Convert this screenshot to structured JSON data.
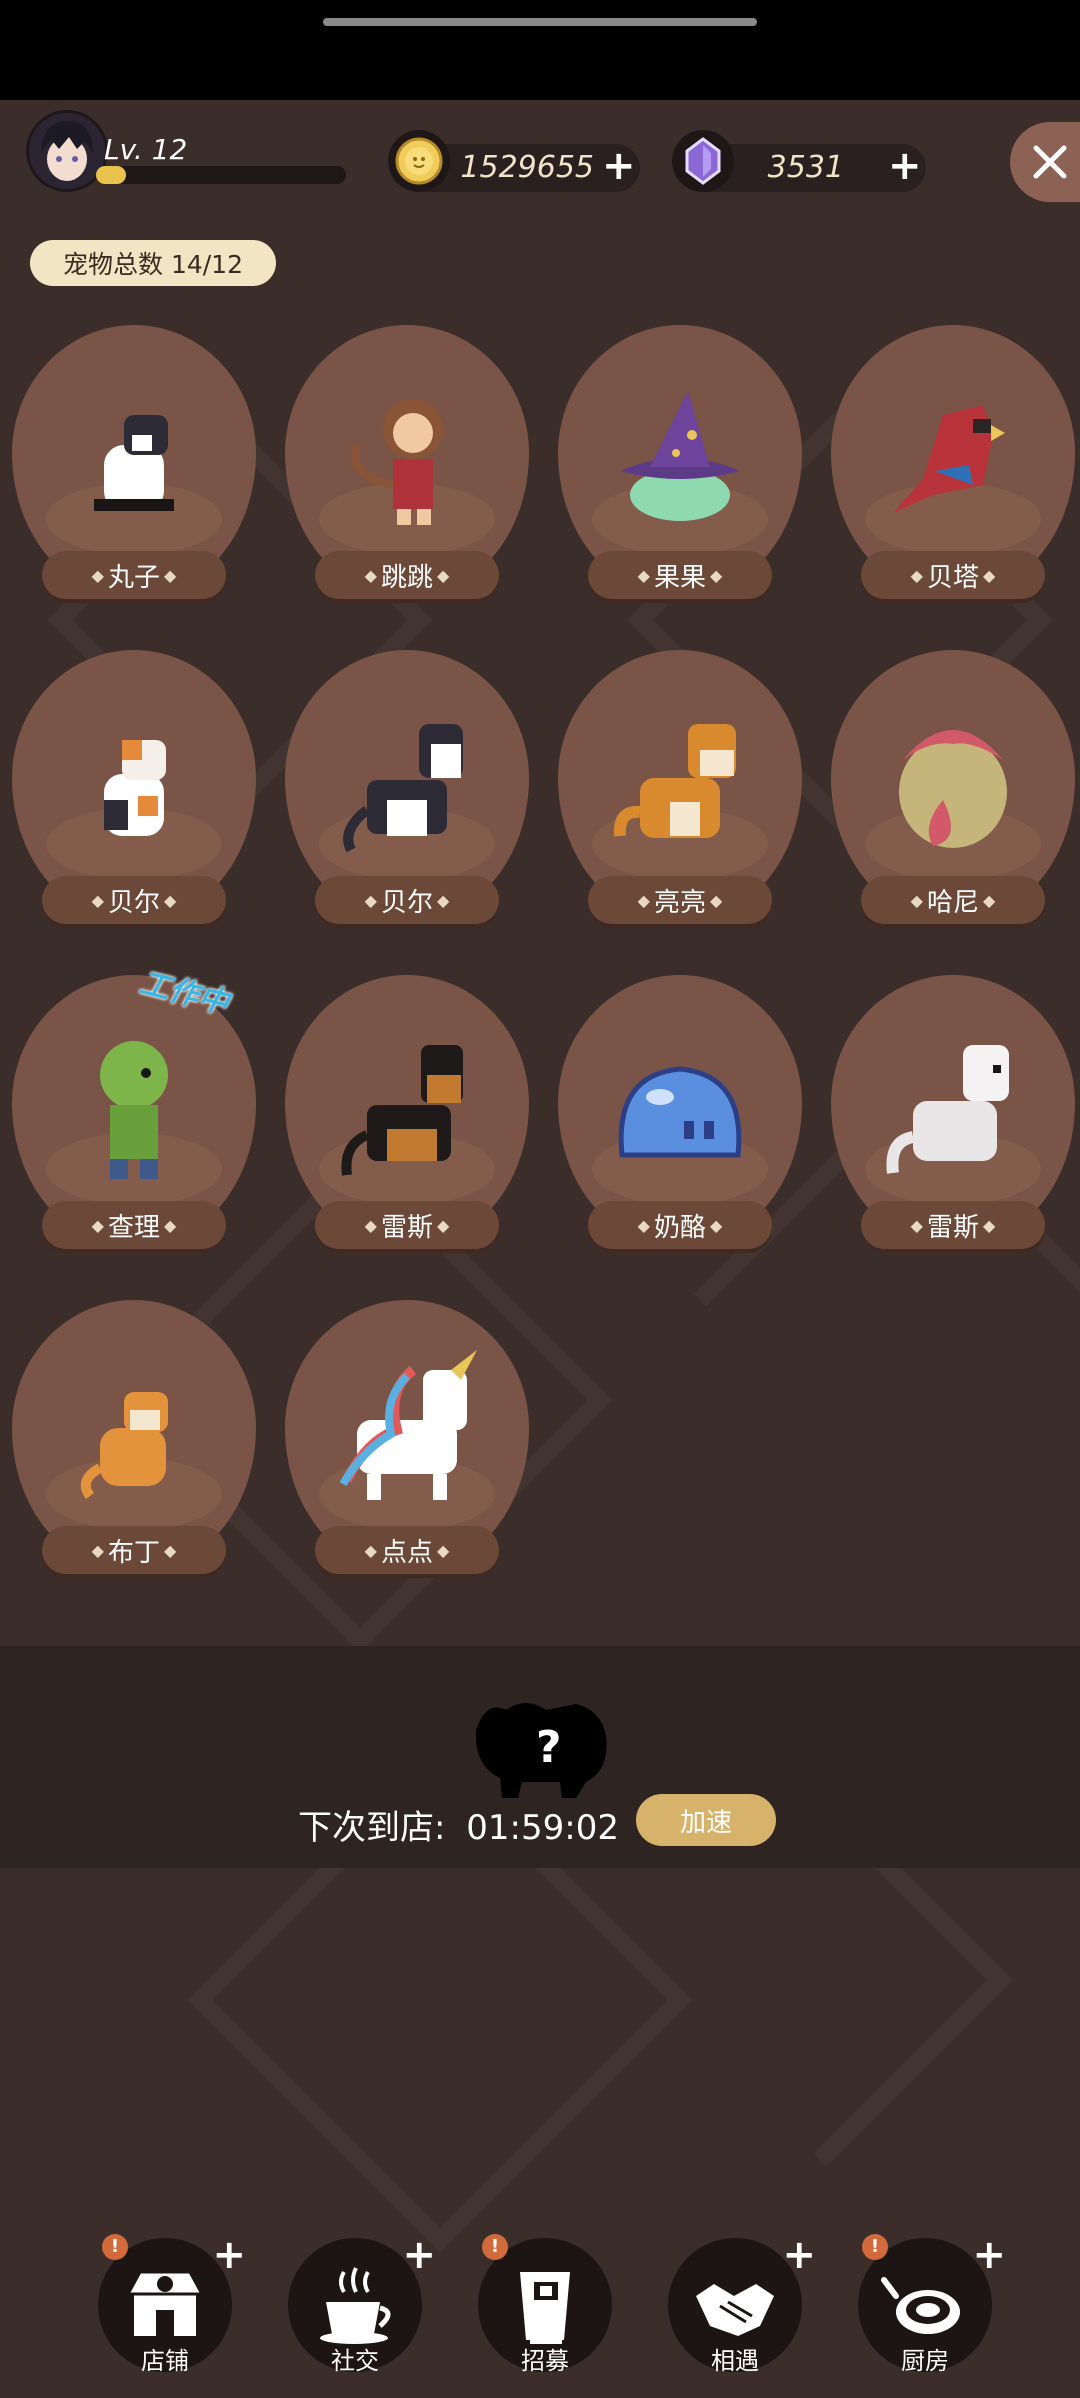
{
  "header": {
    "level_label": "Lv. 12",
    "xp_progress": 0.12,
    "coins": "1529655",
    "gems": "3531"
  },
  "pet_count_label": "宠物总数 14/12",
  "pets": [
    {
      "name": "丸子",
      "icon": "black-white-cat-icon"
    },
    {
      "name": "跳跳",
      "icon": "monkey-icon"
    },
    {
      "name": "果果",
      "icon": "wizard-hat-slime-icon"
    },
    {
      "name": "贝塔",
      "icon": "red-parrot-icon"
    },
    {
      "name": "贝尔",
      "icon": "calico-cat-icon"
    },
    {
      "name": "贝尔",
      "icon": "husky-icon"
    },
    {
      "name": "亮亮",
      "icon": "shiba-icon"
    },
    {
      "name": "哈尼",
      "icon": "shell-creature-icon"
    },
    {
      "name": "查理",
      "icon": "goblin-icon",
      "status": "工作中"
    },
    {
      "name": "雷斯",
      "icon": "german-shepherd-icon"
    },
    {
      "name": "奶酪",
      "icon": "blue-slime-icon"
    },
    {
      "name": "雷斯",
      "icon": "white-dog-icon"
    },
    {
      "name": "布丁",
      "icon": "orange-cat-icon"
    },
    {
      "name": "点点",
      "icon": "unicorn-icon"
    }
  ],
  "arrival": {
    "label": "下次到店:",
    "time": "01:59:02",
    "speed_button": "加速"
  },
  "nav": [
    {
      "label": "店铺",
      "icon": "shop-icon",
      "plus": true,
      "alert": true
    },
    {
      "label": "社交",
      "icon": "coffee-cup-icon",
      "plus": true,
      "alert": false
    },
    {
      "label": "招募",
      "icon": "door-icon",
      "plus": false,
      "alert": true
    },
    {
      "label": "相遇",
      "icon": "handshake-icon",
      "plus": true,
      "alert": false
    },
    {
      "label": "厨房",
      "icon": "frying-pan-icon",
      "plus": true,
      "alert": true
    }
  ],
  "colors": {
    "background": "#3a2d2a",
    "card": "#7a5547",
    "accent": "#d6b26b",
    "badge": "#f2e5c4"
  }
}
